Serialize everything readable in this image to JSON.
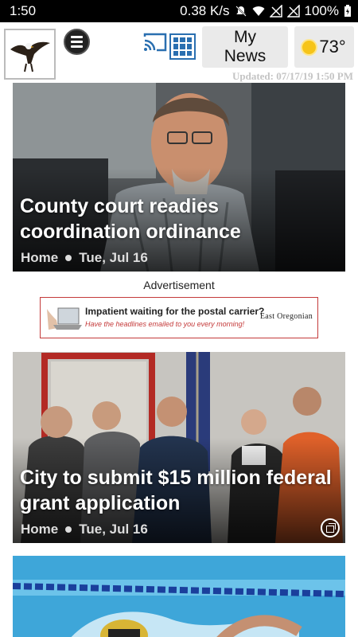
{
  "status_bar": {
    "time": "1:50",
    "network_speed": "0.38 K/s",
    "battery": "100%"
  },
  "header": {
    "my_news_line1": "My",
    "my_news_line2": "News",
    "temperature": "73°",
    "updated": "Updated: 07/17/19 1:50 PM"
  },
  "stories": [
    {
      "headline": "County court readies coordination ordinance",
      "section": "Home",
      "date": "Tue, Jul 16"
    },
    {
      "headline": "City to submit $15 million federal grant application",
      "section": "Home",
      "date": "Tue, Jul 16"
    }
  ],
  "advertisement": {
    "label": "Advertisement",
    "line1": "Impatient waiting for the postal carrier?",
    "line2": "Have the headlines emailed to you every morning!",
    "brand": "East Oregonian"
  },
  "colors": {
    "accent_blue": "#2a6fb0",
    "ad_red": "#c43a3a",
    "sun": "#f6c419"
  }
}
